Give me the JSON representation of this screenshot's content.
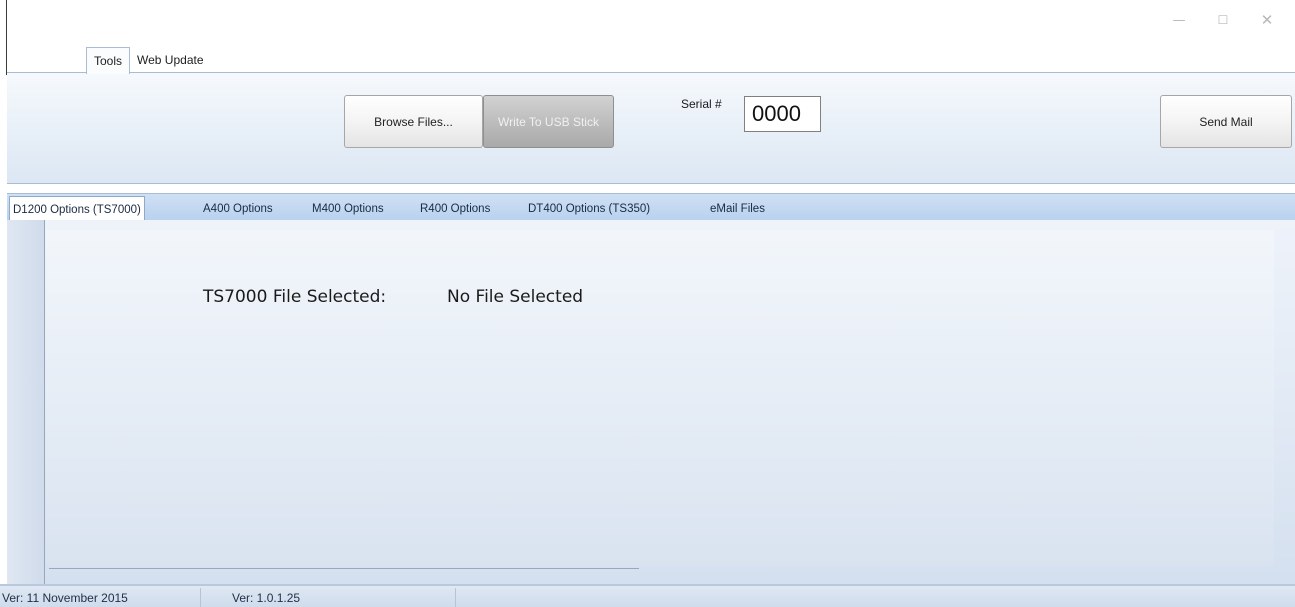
{
  "window": {
    "controls": {
      "minimize": "—",
      "maximize": "☐",
      "close": "✕"
    }
  },
  "ribbon": {
    "tabs": [
      {
        "label": "Tools",
        "active": true
      },
      {
        "label": "Web Update",
        "active": false
      }
    ],
    "browse_label": "Browse Files...",
    "write_label": "Write To USB Stick",
    "serial_label": "Serial #",
    "serial_value": "0000",
    "send_mail_label": "Send Mail"
  },
  "doc_tabs": [
    {
      "label": "D1200 Options (TS7000)",
      "active": true
    },
    {
      "label": "A400 Options",
      "active": false
    },
    {
      "label": "M400 Options",
      "active": false
    },
    {
      "label": "R400 Options",
      "active": false
    },
    {
      "label": "DT400 Options (TS350)",
      "active": false
    },
    {
      "label": "eMail Files",
      "active": false
    }
  ],
  "content": {
    "file_label": "TS7000 File Selected:",
    "file_value": "No File Selected"
  },
  "status": {
    "date_version": "Ver: 11 November 2015",
    "build_version": "Ver: 1.0.1.25"
  },
  "colors": {
    "accent": "#b9d2ee",
    "panel": "#e6eef7"
  }
}
